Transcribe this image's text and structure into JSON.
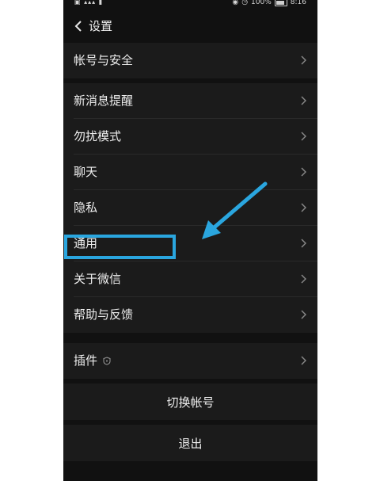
{
  "status_bar": {
    "left_icons": "▣ ▴▴▴ ▮",
    "battery_percent": "100%",
    "time": "8:16"
  },
  "header": {
    "title": "设置"
  },
  "groups": [
    {
      "items": [
        {
          "label": "帐号与安全"
        }
      ]
    },
    {
      "items": [
        {
          "label": "新消息提醒"
        },
        {
          "label": "勿扰模式"
        },
        {
          "label": "聊天"
        },
        {
          "label": "隐私"
        },
        {
          "label": "通用"
        },
        {
          "label": "关于微信"
        },
        {
          "label": "帮助与反馈"
        }
      ]
    },
    {
      "items": [
        {
          "label": "插件",
          "icon": "shield-icon"
        }
      ]
    }
  ],
  "actions": {
    "switch_account": "切换帐号",
    "logout": "退出"
  },
  "annotation": {
    "highlight_color": "#2aa6df",
    "highlight_target": "通用"
  },
  "colors": {
    "background": "#111111",
    "row": "#1b1b1b",
    "text": "#eeeeee",
    "accent": "#2aa6df"
  }
}
